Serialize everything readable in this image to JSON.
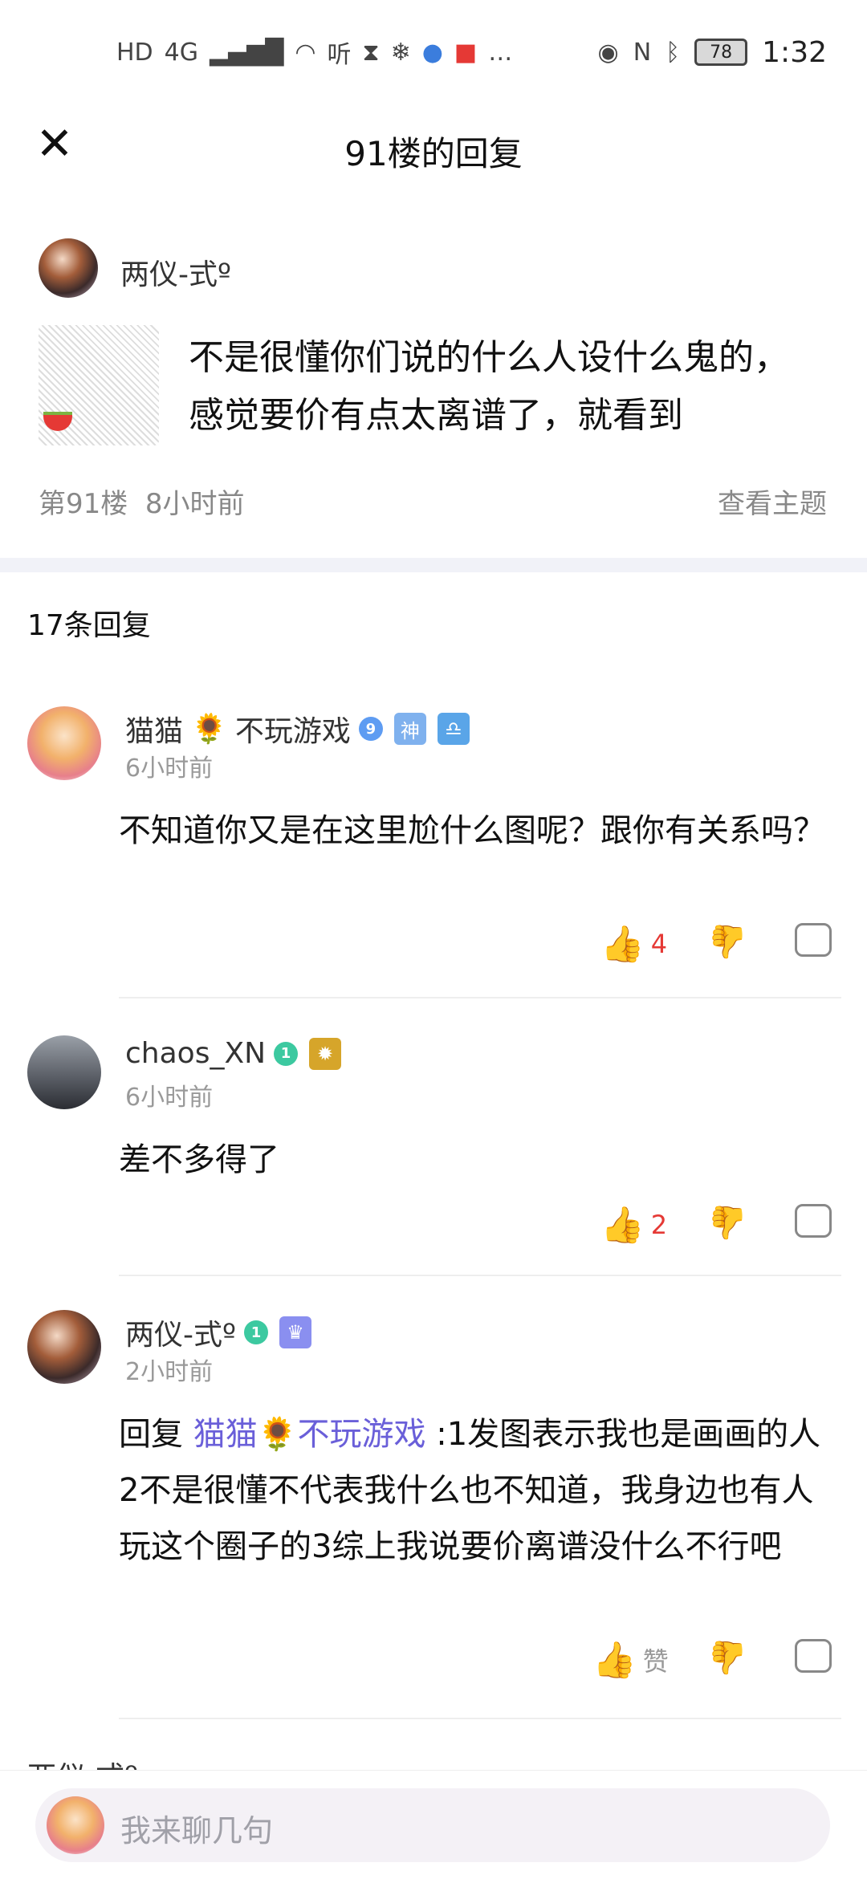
{
  "status_bar": {
    "left_icons": [
      "HD",
      "4G",
      "signal-icon",
      "wifi-icon",
      "听",
      "hourglass-icon",
      "snowflake-icon",
      "globe-icon",
      "book-icon",
      "…"
    ],
    "battery": "78",
    "time": "1:32"
  },
  "header": {
    "title": "91楼的回复"
  },
  "post": {
    "username": "两仪-式º",
    "text": "不是很懂你们说的什么人设什么鬼的，感觉要价有点太离谱了，就看到",
    "floor": "第91楼",
    "time": "8小时前",
    "view_topic": "查看主题"
  },
  "replies_count": "17条回复",
  "replies": [
    {
      "username_prefix": "猫猫",
      "username_emoji": "🌻",
      "username_suffix": "不玩游戏",
      "level": "9",
      "tags": [
        "神",
        "♎"
      ],
      "time": "6小时前",
      "text": "不知道你又是在这里尬什么图呢？跟你有关系吗？",
      "likes": "4"
    },
    {
      "username": "chaos_XN",
      "level": "1",
      "tags": [
        "✹"
      ],
      "time": "6小时前",
      "text": "差不多得了",
      "likes": "2"
    },
    {
      "username": "两仪-式º",
      "level": "1",
      "tags": [
        "♛"
      ],
      "time": "2小时前",
      "reply_label": "回复",
      "mention_prefix": "猫猫",
      "mention_emoji": "🌻",
      "mention_suffix": "不玩游戏",
      "text": " :1发图表示我也是画画的人2不是很懂不代表我什么也不知道，我身边也有人玩这个圈子的3综上我说要价离谱没什么不行吧",
      "likes": "赞"
    }
  ],
  "partial_reply": "两仪-式º",
  "input": {
    "placeholder": "我来聊几句"
  },
  "colors": {
    "accent_like": "#e53935",
    "mention": "#6a5fd9",
    "separator": "#f1f2f8"
  }
}
